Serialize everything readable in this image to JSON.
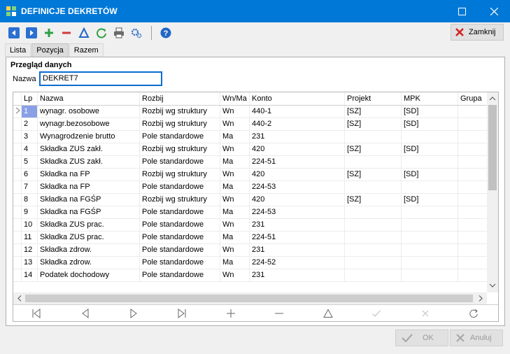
{
  "window": {
    "title": "DEFINICJE DEKRETÓW"
  },
  "toolbar": {
    "icons": [
      "arrow-left-icon",
      "arrow-right-icon",
      "plus-icon",
      "minus-icon",
      "triangle-icon",
      "refresh-icon",
      "printer-icon",
      "settings-icon",
      "help-icon"
    ],
    "close_label": "Zamknij"
  },
  "tabs": [
    {
      "label": "Lista"
    },
    {
      "label": "Pozycja"
    },
    {
      "label": "Razem"
    }
  ],
  "group": {
    "title": "Przegląd danych"
  },
  "name_field": {
    "label": "Nazwa",
    "value": "DEKRET7"
  },
  "grid": {
    "columns": [
      "Lp",
      "Nazwa",
      "Rozbij",
      "Wn/Ma",
      "Konto",
      "Projekt",
      "MPK",
      "Grupa"
    ],
    "rows": [
      [
        "1",
        "wynagr. osobowe",
        "Rozbij wg struktury",
        "Wn",
        "440-1",
        "[SZ]",
        "[SD]",
        ""
      ],
      [
        "2",
        "wynagr.bezosobowe",
        "Rozbij wg struktury",
        "Wn",
        "440-2",
        "[SZ]",
        "[SD]",
        ""
      ],
      [
        "3",
        "Wynagrodzenie brutto",
        "Pole standardowe",
        "Ma",
        "231",
        "",
        "",
        ""
      ],
      [
        "4",
        "Składka ZUS zakł.",
        "Rozbij wg struktury",
        "Wn",
        "420",
        "[SZ]",
        "[SD]",
        ""
      ],
      [
        "5",
        "Składka ZUS zakł.",
        "Pole standardowe",
        "Ma",
        "224-51",
        "",
        "",
        ""
      ],
      [
        "6",
        "Składka na FP",
        "Rozbij wg struktury",
        "Wn",
        "420",
        "[SZ]",
        "[SD]",
        ""
      ],
      [
        "7",
        "Składka na FP",
        "Pole standardowe",
        "Ma",
        "224-53",
        "",
        "",
        ""
      ],
      [
        "8",
        "Składka na FGŚP",
        "Rozbij wg struktury",
        "Wn",
        "420",
        "[SZ]",
        "[SD]",
        ""
      ],
      [
        "9",
        "Składka na FGŚP",
        "Pole standardowe",
        "Ma",
        "224-53",
        "",
        "",
        ""
      ],
      [
        "10",
        "Składka ZUS prac.",
        "Pole standardowe",
        "Wn",
        "231",
        "",
        "",
        ""
      ],
      [
        "11",
        "Składka ZUS prac.",
        "Pole standardowe",
        "Ma",
        "224-51",
        "",
        "",
        ""
      ],
      [
        "12",
        "Składka zdrow.",
        "Pole standardowe",
        "Wn",
        "231",
        "",
        "",
        ""
      ],
      [
        "13",
        "Składka zdrow.",
        "Pole standardowe",
        "Ma",
        "224-52",
        "",
        "",
        ""
      ],
      [
        "14",
        "Podatek dochodowy",
        "Pole standardowe",
        "Wn",
        "231",
        "",
        "",
        ""
      ]
    ],
    "selected_row": 0
  },
  "navigator": {
    "icons": [
      "first-icon",
      "prior-icon",
      "next-icon",
      "last-icon",
      "insert-icon",
      "delete-icon",
      "edit-icon",
      "post-icon",
      "cancel-icon",
      "refresh-icon"
    ]
  },
  "footer": {
    "ok_label": "OK",
    "cancel_label": "Anuluj"
  },
  "colors": {
    "titlebar": "#0078d7",
    "selection": "#8aa0e6",
    "focus_border": "#0a6dcf"
  }
}
